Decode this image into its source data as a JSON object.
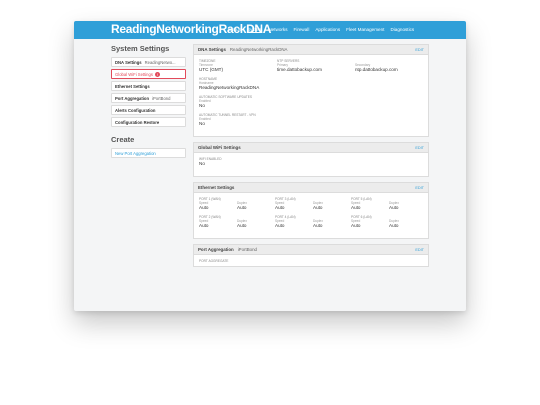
{
  "app": {
    "logo": "ReadingNetworkingRackDNA"
  },
  "nav": [
    "Status",
    "System",
    "Networks",
    "Firewall",
    "Applications",
    "Fleet Management",
    "Diagnostics"
  ],
  "sidebar": {
    "title": "System Settings",
    "items": [
      {
        "label": "DNA Settings",
        "sub": "ReadingNetwo..."
      },
      {
        "label": "Global WiFi Settings",
        "badge": "!"
      },
      {
        "label": "Ethernet Settings"
      },
      {
        "label": "Port Aggregation",
        "sub": "iPortBond"
      },
      {
        "label": "Alerts Configuration"
      },
      {
        "label": "Configuration Restore"
      }
    ],
    "create_title": "Create",
    "create_items": [
      {
        "label": "New Port Aggregation"
      }
    ]
  },
  "dna": {
    "title": "DNA Settings",
    "sub": "ReadingNetworkingRackDNA",
    "edit": "EDIT",
    "timezone_label": "TIMEZONE",
    "timezone_sub": "Timezone",
    "timezone_value": "UTC (GMT)",
    "ntp_label": "NTP SERVERS",
    "ntp_primary_label": "Primary",
    "ntp_primary": "time.dattobackup.com",
    "ntp_secondary_label": "Secondary",
    "ntp_secondary": "ntp.dattobackup.com",
    "hostname_label": "HOSTNAME",
    "hostname_sub": "Hostname",
    "hostname_value": "ReadingNetworkingRackDNA",
    "auto_update_label": "AUTOMATIC SOFTWARE UPDATES",
    "auto_update_sub": "Enabled",
    "auto_update_value": "No",
    "vpn_label": "AUTOMATIC TUNNEL RESTART - VPN",
    "vpn_sub": "Enabled",
    "vpn_value": "No"
  },
  "wifi": {
    "title": "Global WiFi Settings",
    "edit": "EDIT",
    "enabled_label": "WIFI ENABLED",
    "enabled_value": "No"
  },
  "ethernet": {
    "title": "Ethernet Settings",
    "edit": "EDIT",
    "ports": [
      {
        "name": "PORT 1 (WAN)",
        "speed_label": "Speed",
        "speed": "Auto",
        "duplex_label": "Duplex",
        "duplex": "Auto"
      },
      {
        "name": "PORT 3 (LAN)",
        "speed_label": "Speed",
        "speed": "Auto",
        "duplex_label": "Duplex",
        "duplex": "Auto"
      },
      {
        "name": "PORT 5 (LAN)",
        "speed_label": "Speed",
        "speed": "Auto",
        "duplex_label": "Duplex",
        "duplex": "Auto"
      },
      {
        "name": "PORT 2 (WAN)",
        "speed_label": "Speed",
        "speed": "Auto",
        "duplex_label": "Duplex",
        "duplex": "Auto"
      },
      {
        "name": "PORT 4 (LAN)",
        "speed_label": "Speed",
        "speed": "Auto",
        "duplex_label": "Duplex",
        "duplex": "Auto"
      },
      {
        "name": "PORT 6 (LAN)",
        "speed_label": "Speed",
        "speed": "Auto",
        "duplex_label": "Duplex",
        "duplex": "Auto"
      }
    ]
  },
  "aggregation": {
    "title": "Port Aggregation",
    "sub": "iPortBond",
    "edit": "EDIT",
    "label": "PORT AGGREGATE"
  }
}
